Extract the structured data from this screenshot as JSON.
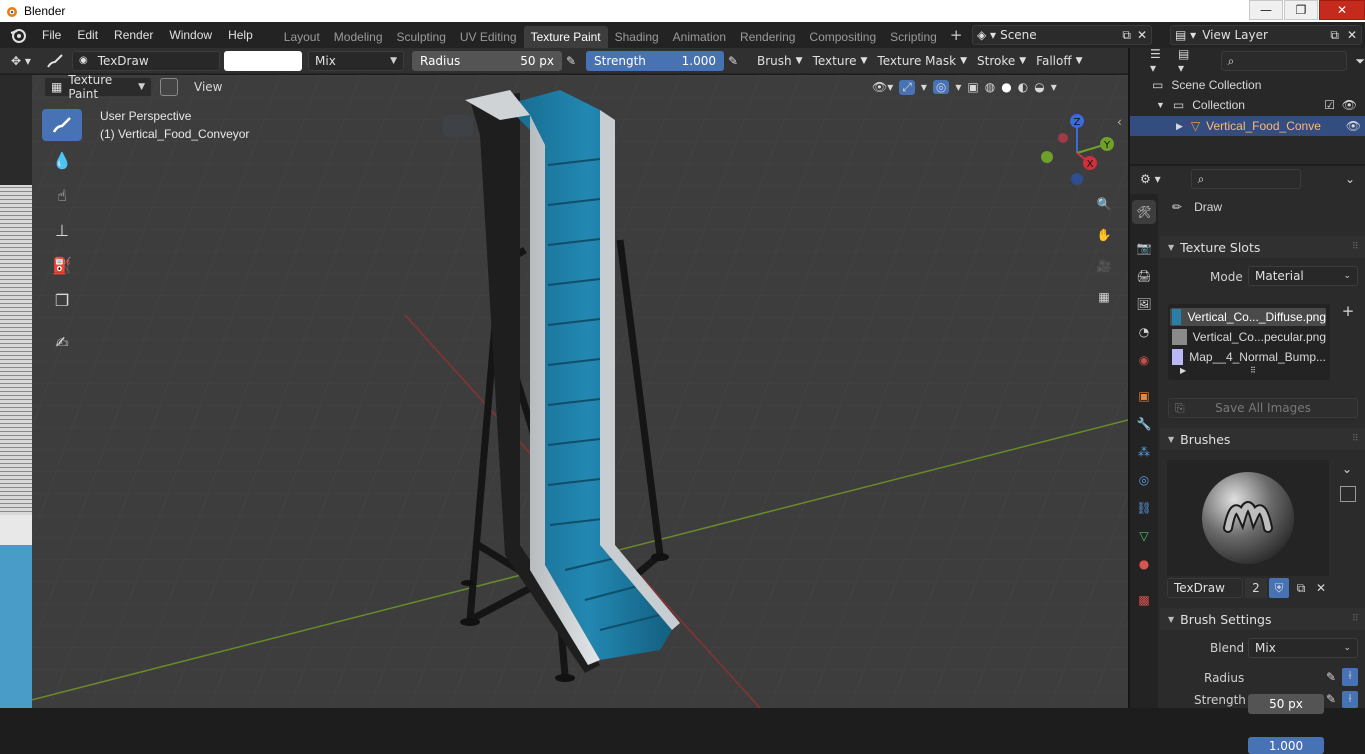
{
  "window": {
    "title": "Blender",
    "btn_min": "—",
    "btn_max": "❐",
    "btn_close": "✕"
  },
  "menu": [
    "File",
    "Edit",
    "Render",
    "Window",
    "Help"
  ],
  "workspaces": [
    {
      "label": "Layout"
    },
    {
      "label": "Modeling"
    },
    {
      "label": "Sculpting"
    },
    {
      "label": "UV Editing"
    },
    {
      "label": "Texture Paint",
      "active": true
    },
    {
      "label": "Shading"
    },
    {
      "label": "Animation"
    },
    {
      "label": "Rendering"
    },
    {
      "label": "Compositing"
    },
    {
      "label": "Scripting"
    }
  ],
  "add_workspace": "+",
  "scene": {
    "name": "Scene",
    "view_layer": "View Layer"
  },
  "toolheader": {
    "brush_name": "TexDraw",
    "blend": "Mix",
    "radius_label": "Radius",
    "radius_value": "50 px",
    "strength_label": "Strength",
    "strength_value": "1.000",
    "strength_fraction": 1.0,
    "menus": [
      "Brush",
      "Texture",
      "Texture Mask",
      "Stroke",
      "Falloff"
    ]
  },
  "viewport": {
    "mode": "Texture Paint",
    "view_menu": "View",
    "perspective": "User Perspective",
    "object_label": "(1) Vertical_Food_Conveyor",
    "gizmo": {
      "z": "Z",
      "y": "Y",
      "x": "X"
    }
  },
  "outliner": {
    "scene_collection": "Scene Collection",
    "collection": "Collection",
    "object": "Vertical_Food_Conve"
  },
  "properties": {
    "tool_name": "Draw",
    "texture_slots_header": "Texture Slots",
    "mode_label": "Mode",
    "mode_value": "Material",
    "slots": [
      "Vertical_Co..._Diffuse.png",
      "Vertical_Co...pecular.png",
      "Map__4_Normal_Bump..."
    ],
    "save_all": "Save All Images",
    "brushes_header": "Brushes",
    "brush_name": "TexDraw",
    "brush_users": "2",
    "brush_settings_header": "Brush Settings",
    "blend_label": "Blend",
    "blend_value": "Mix",
    "radius_label": "Radius",
    "radius_value": "50 px",
    "strength_label": "Strength",
    "strength_value": "1.000"
  },
  "colors": {
    "accent": "#4772b3",
    "conveyor": "#1f7ea8",
    "viewport_bg": "#3d3d3d",
    "close_red": "#c42b1c"
  }
}
